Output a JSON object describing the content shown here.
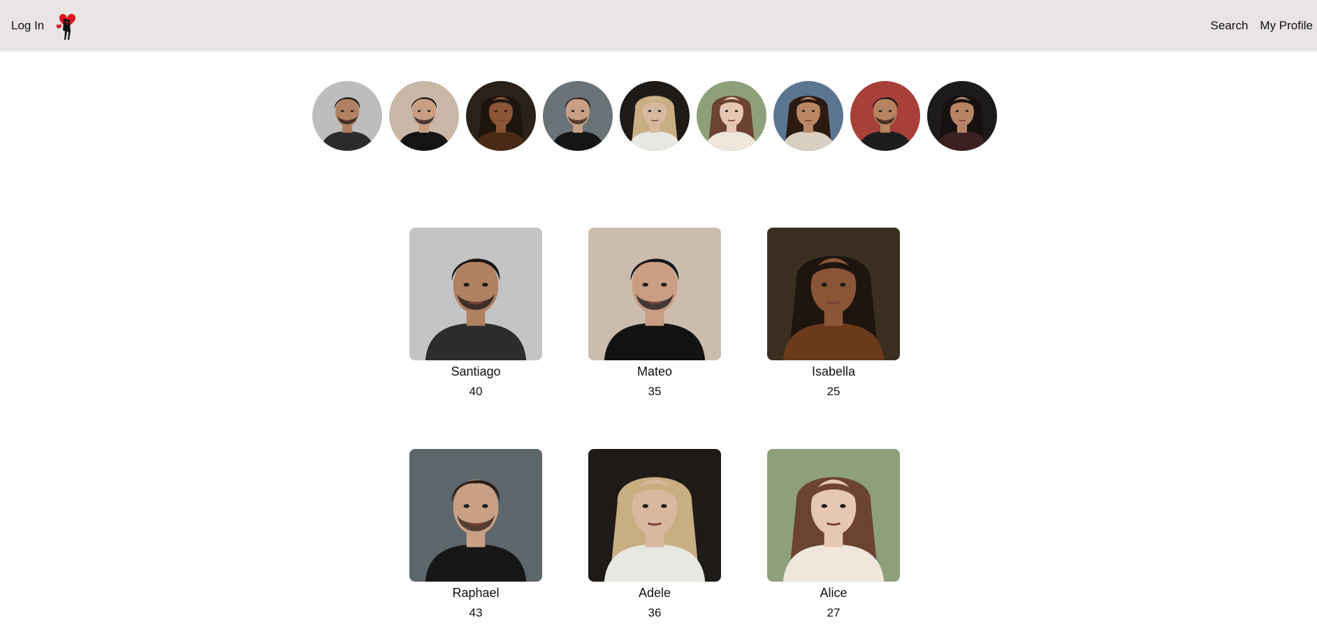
{
  "nav": {
    "login_label": "Log In",
    "search_label": "Search",
    "profile_label": "My Profile",
    "logo_icon": "heart-couple-logo"
  },
  "colors": {
    "navbar_bg": "#e8e5e4",
    "heart": "#e0141c"
  },
  "stories": [
    {
      "icon": "avatar-santiago",
      "bg": "#bdbdbd",
      "skin": "#b08062",
      "hair": "#151515",
      "cloth": "#2b2b2b"
    },
    {
      "icon": "avatar-mateo",
      "bg": "#c9b8a8",
      "skin": "#c99e82",
      "hair": "#14161b",
      "cloth": "#141414"
    },
    {
      "icon": "avatar-isabella",
      "bg": "#2a2119",
      "skin": "#8a5536",
      "hair": "#1e140e",
      "cloth": "#4a2a16"
    },
    {
      "icon": "avatar-raphael",
      "bg": "#6a7378",
      "skin": "#c9a085",
      "hair": "#2a1d16",
      "cloth": "#151515"
    },
    {
      "icon": "avatar-adele",
      "bg": "#1d1a18",
      "skin": "#d8b9a0",
      "hair": "#c9ae82",
      "cloth": "#e8e8e2"
    },
    {
      "icon": "avatar-alice",
      "bg": "#8ea07a",
      "skin": "#e6c7b4",
      "hair": "#6b4330",
      "cloth": "#efe6dc"
    },
    {
      "icon": "avatar-woman-curly",
      "bg": "#5b7590",
      "skin": "#b98765",
      "hair": "#2a1a12",
      "cloth": "#d9cfc0"
    },
    {
      "icon": "avatar-man-glasses",
      "bg": "#a8403a",
      "skin": "#b5835f",
      "hair": "#1a1410",
      "cloth": "#1d1d1d"
    },
    {
      "icon": "avatar-woman-dark",
      "bg": "#1c1a1a",
      "skin": "#b88466",
      "hair": "#161010",
      "cloth": "#3a2020"
    }
  ],
  "profiles": [
    {
      "name": "Santiago",
      "age": "40",
      "icon": "photo-santiago",
      "bg": "#c4c4c4",
      "skin": "#b08062",
      "hair": "#151515",
      "cloth": "#2e2c2a"
    },
    {
      "name": "Mateo",
      "age": "35",
      "icon": "photo-mateo",
      "bg": "#cbbcae",
      "skin": "#c99e82",
      "hair": "#14161b",
      "cloth": "#121212"
    },
    {
      "name": "Isabella",
      "age": "25",
      "icon": "photo-isabella",
      "bg": "#3a2e20",
      "skin": "#8a5536",
      "hair": "#1e140e",
      "cloth": "#6b3a1c"
    },
    {
      "name": "Raphael",
      "age": "43",
      "icon": "photo-raphael",
      "bg": "#5d666b",
      "skin": "#c9a085",
      "hair": "#2a1d16",
      "cloth": "#161616"
    },
    {
      "name": "Adele",
      "age": "36",
      "icon": "photo-adele",
      "bg": "#1d1a18",
      "skin": "#d8b9a0",
      "hair": "#c9ae82",
      "cloth": "#e8e8e2"
    },
    {
      "name": "Alice",
      "age": "27",
      "icon": "photo-alice",
      "bg": "#8ea07a",
      "skin": "#e6c7b4",
      "hair": "#6b4330",
      "cloth": "#efe6dc"
    }
  ]
}
